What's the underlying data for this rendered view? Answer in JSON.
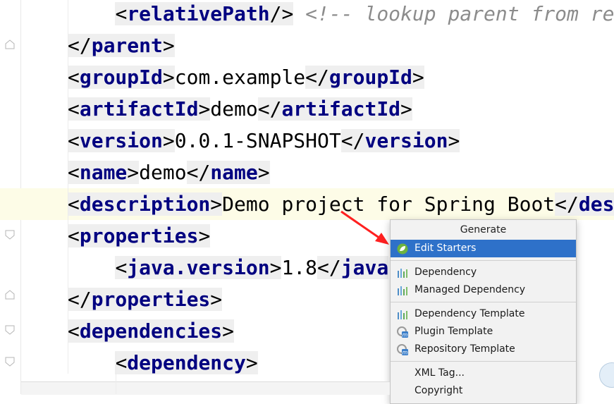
{
  "editor": {
    "lines": [
      {
        "indent": "    ",
        "tag": "relativePath",
        "kind": "selfclose",
        "comment": "<!-- lookup parent from re"
      },
      {
        "indent": "",
        "tag": "parent",
        "kind": "close"
      },
      {
        "indent": "",
        "tag": "groupId",
        "kind": "pair",
        "value": "com.example"
      },
      {
        "indent": "",
        "tag": "artifactId",
        "kind": "pair",
        "value": "demo"
      },
      {
        "indent": "",
        "tag": "version",
        "kind": "pair",
        "value": "0.0.1-SNAPSHOT"
      },
      {
        "indent": "",
        "tag": "name",
        "kind": "pair",
        "value": "demo"
      },
      {
        "indent": "",
        "tag": "description",
        "kind": "pair_trunc",
        "value": "Demo project for Spring Boot",
        "close_visible": "des",
        "current": true
      },
      {
        "indent": "",
        "tag": "properties",
        "kind": "open"
      },
      {
        "indent": "    ",
        "tag": "java.version",
        "kind": "pair_trunc",
        "value": "1.8",
        "close_visible": "java"
      },
      {
        "indent": "",
        "tag": "properties",
        "kind": "close"
      },
      {
        "indent": "",
        "tag": "dependencies",
        "kind": "open"
      },
      {
        "indent": "    ",
        "tag": "dependency",
        "kind": "open"
      }
    ]
  },
  "popup": {
    "title": "Generate",
    "groups": [
      [
        {
          "label": "Edit Starters",
          "icon": "spring-leaf-icon",
          "selected": true
        }
      ],
      [
        {
          "label": "Dependency",
          "icon": "dependency-bars-icon"
        },
        {
          "label": "Managed Dependency",
          "icon": "dependency-bars-icon"
        }
      ],
      [
        {
          "label": "Dependency Template",
          "icon": "dependency-bars-icon"
        },
        {
          "label": "Plugin Template",
          "icon": "maven-template-icon"
        },
        {
          "label": "Repository Template",
          "icon": "maven-template-icon"
        }
      ],
      [
        {
          "label": "XML Tag...",
          "icon": ""
        },
        {
          "label": "Copyright",
          "icon": ""
        }
      ]
    ]
  },
  "colors": {
    "tag": "#000080",
    "comment": "#8c8c8c",
    "selection": "#2e71c9",
    "arrow": "#ff2020",
    "spring": "#6db33f"
  }
}
